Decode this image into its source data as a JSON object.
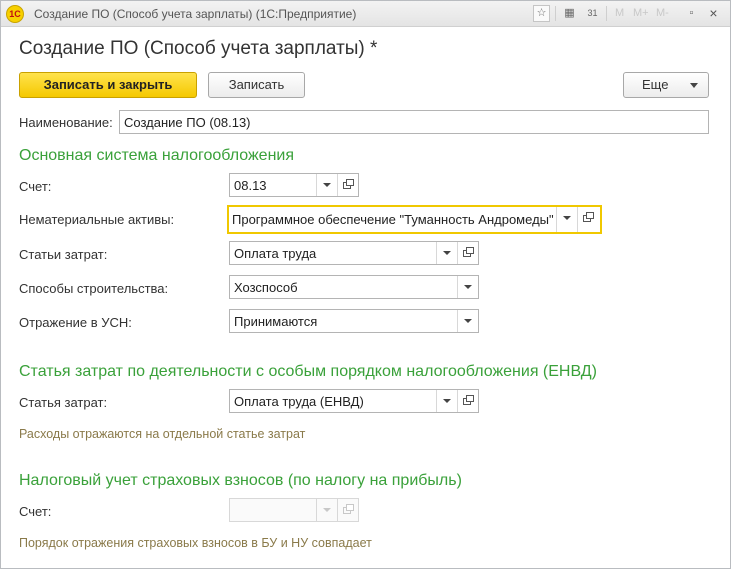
{
  "window": {
    "title": "Создание ПО (Способ учета зарплаты)  (1С:Предприятие)",
    "logo_text": "1С",
    "toolbar_icons": [
      "bookmark-icon",
      "calculator-icon",
      "calendar-icon",
      "m-icon",
      "m-plus-icon",
      "m-minus-icon",
      "restore-icon",
      "close-icon"
    ],
    "toolbar": {
      "m": "M",
      "m_plus": "M+",
      "m_minus": "M-",
      "calendar": "31"
    }
  },
  "form": {
    "title": "Создание ПО (Способ учета зарплаты) *",
    "save_close_label": "Записать и закрыть",
    "save_label": "Записать",
    "more_label": "Еще",
    "name_label": "Наименование:",
    "name_value": "Создание ПО (08.13)"
  },
  "main_tax": {
    "heading": "Основная система налогообложения",
    "account_label": "Счет:",
    "account_value": "08.13",
    "intangible_label": "Нематериальные активы:",
    "intangible_value": "Программное обеспечение \"Туманность Андромеды\"",
    "cost_items_label": "Статьи затрат:",
    "cost_items_value": "Оплата труда",
    "construction_label": "Способы строительства:",
    "construction_value": "Хозспособ",
    "usn_label": "Отражение в УСН:",
    "usn_value": "Принимаются"
  },
  "envd": {
    "heading": "Статья затрат по деятельности с особым порядком налогообложения (ЕНВД)",
    "cost_item_label": "Статья затрат:",
    "cost_item_value": "Оплата труда (ЕНВД)",
    "note": "Расходы отражаются на отдельной статье затрат"
  },
  "insurance": {
    "heading": "Налоговый учет страховых взносов (по налогу на прибыль)",
    "account_label": "Счет:",
    "account_value": "",
    "note": "Порядок отражения страховых взносов в БУ и НУ совпадает"
  },
  "colors": {
    "accent_green": "#3aa13a",
    "primary_button": "#f5c800",
    "note_text": "#8a7a4a"
  }
}
